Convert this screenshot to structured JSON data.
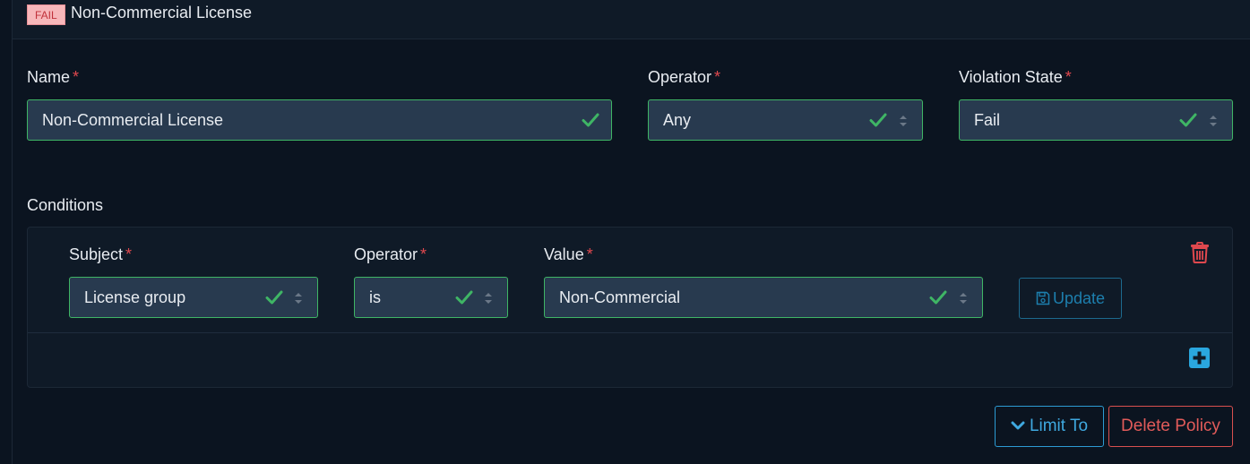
{
  "header": {
    "state_badge": "FAIL",
    "title": "Non-Commercial License"
  },
  "form": {
    "name": {
      "label": "Name",
      "required_mark": "*",
      "value": "Non-Commercial License"
    },
    "operator": {
      "label": "Operator",
      "required_mark": "*",
      "value": "Any"
    },
    "violation_state": {
      "label": "Violation State",
      "required_mark": "*",
      "value": "Fail"
    }
  },
  "conditions": {
    "label": "Conditions",
    "rows": [
      {
        "subject": {
          "label": "Subject",
          "required_mark": "*",
          "value": "License group"
        },
        "operator": {
          "label": "Operator",
          "required_mark": "*",
          "value": "is"
        },
        "value": {
          "label": "Value",
          "required_mark": "*",
          "value": "Non-Commercial"
        },
        "update_label": "Update"
      }
    ]
  },
  "actions": {
    "limit_to_label": "Limit To",
    "delete_policy_label": "Delete Policy"
  },
  "colors": {
    "valid_border": "#3fb565",
    "fail_badge_bg": "#f7b7ba",
    "accent_blue": "#3fa9e0",
    "danger_red": "#e25b5a"
  },
  "icons": {
    "valid": "check-icon",
    "select": "caret-updown-icon",
    "remove_condition": "trash-icon",
    "update": "floppy-icon",
    "add_condition": "plus-square-icon",
    "limit_to": "chevron-down-icon"
  }
}
